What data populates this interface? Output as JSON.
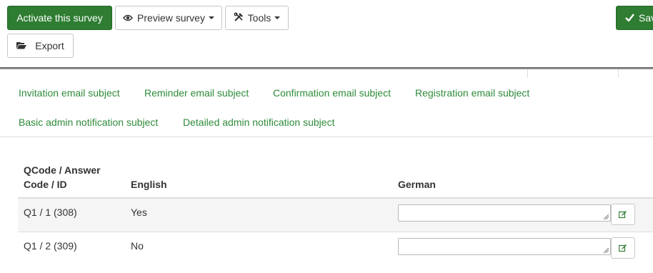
{
  "toolbar": {
    "activate_label": "Activate this survey",
    "preview_label": "Preview survey",
    "preview_icon": "eye-icon",
    "tools_label": "Tools",
    "tools_icon": "tools-icon",
    "save_label": "Sav",
    "save_icon": "checkmark-icon",
    "export_label": "Export",
    "export_icon": "folder-open-icon"
  },
  "tabs": [
    {
      "label": "Invitation email subject"
    },
    {
      "label": "Reminder email subject"
    },
    {
      "label": "Confirmation email subject"
    },
    {
      "label": "Registration email subject"
    },
    {
      "label": "Basic admin notification subject"
    },
    {
      "label": "Detailed admin notification subject"
    }
  ],
  "table": {
    "headers": {
      "qcode_line1": "QCode / Answer",
      "qcode_line2": "Code / ID",
      "english": "English",
      "german": "German"
    },
    "rows": [
      {
        "code": "Q1 / 1 (308)",
        "english": "Yes",
        "german": ""
      },
      {
        "code": "Q1 / 2 (309)",
        "english": "No",
        "german": ""
      }
    ]
  },
  "colors": {
    "primary_green": "#2e7d32",
    "link_green": "#2e8b3a"
  }
}
